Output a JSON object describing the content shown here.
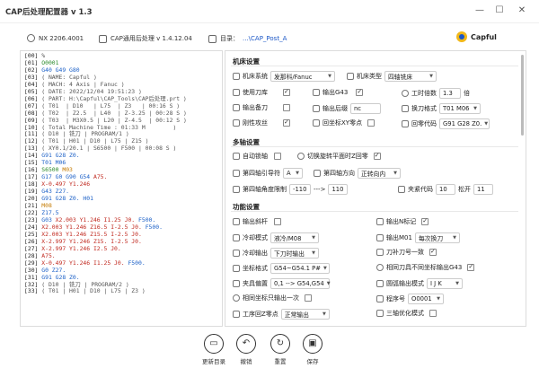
{
  "window": {
    "title": "CAP后处理配置器 v 1.3",
    "minimize": "—",
    "maximize": "☐",
    "close": "✕"
  },
  "info": {
    "nx": "NX 2206.4001",
    "cap": "CAP通用后处理 v 1.4.12.04",
    "dir_label": "目录：",
    "dir_value": "...\\CAP_Post_A",
    "brand": "Capful"
  },
  "code_lines": [
    [
      [
        "%",
        "gray"
      ]
    ],
    [
      [
        "O0001",
        "green"
      ]
    ],
    [
      [
        "G40 G49 G80",
        "blue"
      ]
    ],
    [
      [
        "( NAME: Capful )",
        "gray"
      ]
    ],
    [
      [
        "( MACH: 4 Axis | Fanuc )",
        "gray"
      ]
    ],
    [
      [
        "( DATE: 2022/12/04 19:51:23 )",
        "gray"
      ]
    ],
    [
      [
        "( PART: H:\\Capful\\CAP_Tools\\CAP后处理.prt )",
        "gray"
      ]
    ],
    [
      [
        "( T01  | D10   | L75  | Z3   | 00:16 S )",
        "gray"
      ]
    ],
    [
      [
        "( T02  | Z2.5  | L40  | Z-3.25 | 00:28 S )",
        "gray"
      ]
    ],
    [
      [
        "( T03  | M3X0.5 | L20 | Z-4.5  | 00:12 S )",
        "gray"
      ]
    ],
    [
      [
        "( Total Machine Time : 01:33 M        )",
        "gray"
      ]
    ],
    [
      [
        "( D10 | 铣刀 | PROGRAM/1 )",
        "gray"
      ]
    ],
    [
      [
        "( T01 | H01 | D10 | L75 | Z15 )",
        "gray"
      ]
    ],
    [
      [
        "( XY0.1/20.1 | S6500 | F500 | 00:08 S )",
        "gray"
      ]
    ],
    [
      [
        "G91 G28 Z0.",
        "blue"
      ]
    ],
    [
      [
        "T01 M06",
        "blue"
      ]
    ],
    [
      [
        "S6500 ",
        "green"
      ],
      [
        "M03",
        "orange"
      ]
    ],
    [
      [
        "G17 G0 G90 G54 ",
        "blue"
      ],
      [
        "A75.",
        "red"
      ]
    ],
    [
      [
        "X-0.497 Y1.246",
        "red"
      ]
    ],
    [
      [
        "G43 Z27.",
        "blue"
      ]
    ],
    [
      [
        "G91 G28 Z0. ",
        "blue"
      ],
      [
        "H01",
        "blue"
      ]
    ],
    [
      [
        "M08",
        "orange"
      ]
    ],
    [
      [
        "Z17.5",
        "blue"
      ]
    ],
    [
      [
        "G03 ",
        "blue"
      ],
      [
        "X2.003 Y1.246 ",
        "red"
      ],
      [
        "I1.25 J0. ",
        "red"
      ],
      [
        "F500.",
        "blue"
      ]
    ],
    [
      [
        "X2.003 Y1.246 ",
        "red"
      ],
      [
        "Z16.5 I-2.5 J0. ",
        "red"
      ],
      [
        "F500.",
        "blue"
      ]
    ],
    [
      [
        "X2.003 Y1.246 ",
        "red"
      ],
      [
        "Z15.5 I-2.5 J0.",
        "red"
      ]
    ],
    [
      [
        "X-2.997 Y1.246 ",
        "red"
      ],
      [
        "Z15. I-2.5 J0.",
        "red"
      ]
    ],
    [
      [
        "X-2.997 Y1.246 I2.5 J0.",
        "red"
      ]
    ],
    [
      [
        "A75.",
        "red"
      ]
    ],
    [
      [
        "X-0.497 Y1.246 ",
        "red"
      ],
      [
        "I1.25 J0. ",
        "red"
      ],
      [
        "F500.",
        "blue"
      ]
    ],
    [
      [
        "G0 Z27.",
        "blue"
      ]
    ],
    [
      [
        "G91 G28 Z0.",
        "blue"
      ]
    ],
    [
      [
        "( D10 | 铣刀 | PROGRAM/2 )",
        "gray"
      ]
    ],
    [
      [
        "( T01 | H01 | D10 | L75 | Z3 )",
        "gray"
      ]
    ]
  ],
  "machine": {
    "section": "机床设置",
    "system_label": "机床系统",
    "system_value": "发那科/Fanuc",
    "type_label": "机床类型",
    "type_value": "四轴铣床",
    "use_tool_label": "使用刀库",
    "g43_label": "输出G43",
    "ratio_label": "工时倍数",
    "ratio_value": "1.3",
    "ratio_unit": "倍",
    "backup_label": "输出备刀",
    "tail_label": "输出后缀",
    "tail_value": "nc",
    "toolchange_label": "换刀格式",
    "toolchange_value": "T01 M06",
    "measure_label": "刚性攻丝",
    "xy_label": "回坐标XY零点",
    "return_label": "回零代码",
    "return_value": "G91 G28 Z0."
  },
  "multi": {
    "section": "多轴设置",
    "auto_lock_label": "自动锁轴",
    "rotary_label": "切换旋转平面时Z回零",
    "axis4_lead_label": "第四轴引导符",
    "axis4_lead_value": "A",
    "axis4_dir_label": "第四轴方向",
    "axis4_dir_value": "正转向内",
    "axis4_limit_label": "第四轴角度限制",
    "limit_min": "-110",
    "limit_arrow": "--->",
    "limit_max": "110",
    "clamp_label": "夹紧代码",
    "clamp_value": "10",
    "release_label": "松开",
    "release_value": "11"
  },
  "func": {
    "section": "功能设置",
    "slope_label": "输出斜杆",
    "n_label": "输出N标记",
    "coolant_label": "冷却模式",
    "coolant_value": "液冷/M08",
    "m01_label": "输出M01",
    "m01_value": "每次换刀",
    "cool_out_label": "冷却输出",
    "cool_out_value": "下刀时输出",
    "tool_label": "刀补刀号一致",
    "coord_label": "坐标格式",
    "coord_value": "G54~G54.1 P#",
    "same_g43_label": "相同刀具不同坐标输出G43",
    "fixture_label": "夹具偏置",
    "fixture_value": "0,1 --> G54,G54",
    "arc_label": "圆弧输出模式",
    "arc_value": "I J K",
    "same_coord_label": "相同坐标只输出一次",
    "prog_label": "程序号",
    "prog_value": "O0001",
    "z_return_label": "工序回Z零点",
    "z_return_value": "正常输出",
    "three_axis_label": "三轴优化模式"
  },
  "toolbar": {
    "refresh": "更新目录",
    "undo": "撤销",
    "reset": "重置",
    "save": "保存"
  }
}
